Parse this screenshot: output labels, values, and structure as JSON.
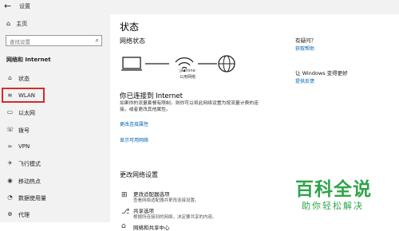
{
  "window": {
    "title": "设置"
  },
  "sidebar": {
    "home": "主页",
    "search_placeholder": "查找设置",
    "section": "网络和 Internet",
    "items": [
      {
        "label": "状态",
        "icon": "home-network-icon"
      },
      {
        "label": "WLAN",
        "icon": "wifi-icon"
      },
      {
        "label": "以太网",
        "icon": "ethernet-icon"
      },
      {
        "label": "拨号",
        "icon": "dialup-icon"
      },
      {
        "label": "VPN",
        "icon": "vpn-icon"
      },
      {
        "label": "飞行模式",
        "icon": "airplane-icon"
      },
      {
        "label": "移动热点",
        "icon": "hotspot-icon"
      },
      {
        "label": "数据使用量",
        "icon": "data-usage-icon"
      },
      {
        "label": "代理",
        "icon": "globe-icon"
      }
    ]
  },
  "main": {
    "title": "状态",
    "network_status": "网络状态",
    "wifi_name": "jasmine",
    "wifi_type": "公用网络",
    "connected": "你已连接到 Internet",
    "description": "如果你的流量套餐有限制，则你可以将此网络设置为按流量计费的连接，或者更改其他属性。",
    "change_props": "更改连接属性",
    "show_networks": "显示可用网络",
    "change_settings": "更改网络设置",
    "options": [
      {
        "title": "更改适配器选项",
        "desc": "查看网络适配器并更改连接设置。",
        "icon": "adapter-icon"
      },
      {
        "title": "共享选项",
        "desc": "根据所连接到的网络，决定要共享的内容。",
        "icon": "share-icon"
      },
      {
        "title": "网络和共享中心",
        "desc": "",
        "icon": "network-center-icon"
      }
    ]
  },
  "right": {
    "help_title": "有疑问？",
    "help_link": "获取帮助",
    "improve_title": "让 Windows 变得更好",
    "feedback_link": "提供反馈"
  },
  "watermark": {
    "main": "百科全说",
    "sub": "助你轻松解决"
  },
  "colors": {
    "accent_link": "#0063b1",
    "highlight": "#d62b2b",
    "watermark": "#2fa44a"
  }
}
